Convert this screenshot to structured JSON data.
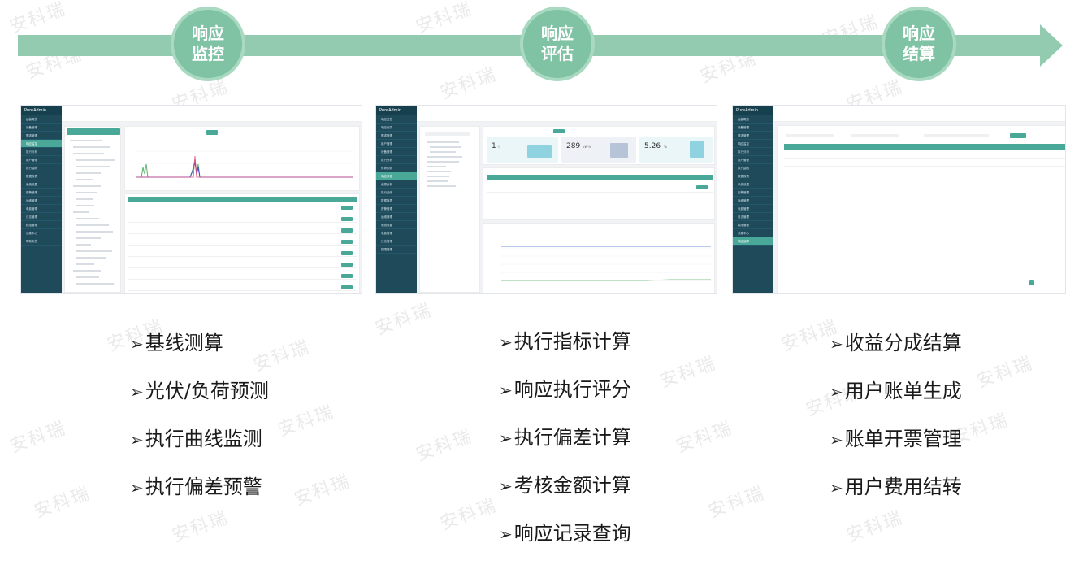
{
  "process": {
    "stages": [
      {
        "line1": "响应",
        "line2": "监控"
      },
      {
        "line1": "响应",
        "line2": "评估"
      },
      {
        "line1": "响应",
        "line2": "结算"
      }
    ]
  },
  "watermark_text": "安科瑞",
  "screenshots": [
    {
      "logo": "PureAdmin",
      "menu": [
        "运营概览",
        "设备管理",
        "需求管理",
        "响应监控",
        "执行分析",
        "用户管理",
        "执行曲线",
        "数据报表",
        "系统设置",
        "告警管理",
        "运维管理",
        "电费管理",
        "日志管理",
        "权限管理",
        "消息中心",
        "帮助文档"
      ],
      "active_index": 3
    },
    {
      "logo": "PureAdmin",
      "menu": [
        "响应监控",
        "响应记录",
        "需求管理",
        "用户管理",
        "设备管理",
        "执行分析",
        "负荷预测",
        "响应评估",
        "资源分析",
        "执行曲线",
        "数据报表",
        "告警管理",
        "运维管理",
        "系统设置",
        "电费管理",
        "日志管理",
        "权限管理"
      ],
      "active_index": 7,
      "stats": [
        {
          "value": "1",
          "unit": "个"
        },
        {
          "value": "289",
          "unit": "kW·h"
        },
        {
          "value": "5.26",
          "unit": "%"
        }
      ]
    },
    {
      "logo": "PureAdmin",
      "menu": [
        "运营概览",
        "设备管理",
        "需求管理",
        "响应监控",
        "执行分析",
        "用户管理",
        "执行曲线",
        "数据报表",
        "系统设置",
        "告警管理",
        "运维管理",
        "电费管理",
        "日志管理",
        "权限管理",
        "消息中心",
        "响应结算"
      ],
      "active_index": 15
    }
  ],
  "features": {
    "bullet": "➢",
    "monitor": [
      "基线测算",
      "光伏/负荷预测",
      "执行曲线监测",
      "执行偏差预警"
    ],
    "evaluate": [
      "执行指标计算",
      "响应执行评分",
      "执行偏差计算",
      "考核金额计算",
      "响应记录查询"
    ],
    "settle": [
      "收益分成结算",
      "用户账单生成",
      "账单开票管理",
      "用户费用结转"
    ]
  },
  "colors": {
    "arrow": "#93cbb0",
    "circle": "#7fc2a4",
    "sidebar": "#1e4a5a",
    "accent": "#4aa898"
  }
}
